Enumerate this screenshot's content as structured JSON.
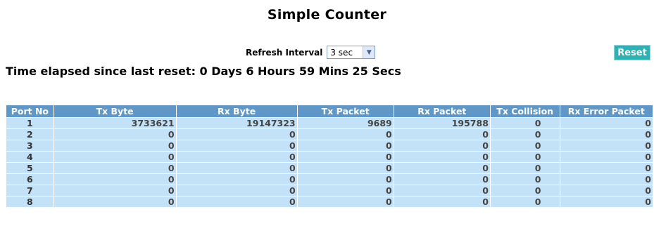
{
  "title": "Simple Counter",
  "refresh": {
    "label": "Refresh Interval",
    "selected": "3 sec"
  },
  "reset_label": "Reset",
  "elapsed": "Time elapsed since last reset: 0 Days 6 Hours 59 Mins 25 Secs",
  "table": {
    "headers": [
      "Port No",
      "Tx Byte",
      "Rx Byte",
      "Tx Packet",
      "Rx Packet",
      "Tx Collision",
      "Rx Error Packet"
    ],
    "rows": [
      [
        "1",
        "3733621",
        "19147323",
        "9689",
        "195788",
        "0",
        "0"
      ],
      [
        "2",
        "0",
        "0",
        "0",
        "0",
        "0",
        "0"
      ],
      [
        "3",
        "0",
        "0",
        "0",
        "0",
        "0",
        "0"
      ],
      [
        "4",
        "0",
        "0",
        "0",
        "0",
        "0",
        "0"
      ],
      [
        "5",
        "0",
        "0",
        "0",
        "0",
        "0",
        "0"
      ],
      [
        "6",
        "0",
        "0",
        "0",
        "0",
        "0",
        "0"
      ],
      [
        "7",
        "0",
        "0",
        "0",
        "0",
        "0",
        "0"
      ],
      [
        "8",
        "0",
        "0",
        "0",
        "0",
        "0",
        "0"
      ]
    ]
  },
  "colors": {
    "header_bg": "#5f98c8",
    "row_bg": "#c4e2f7",
    "reset_bg": "#2eb1b5"
  }
}
